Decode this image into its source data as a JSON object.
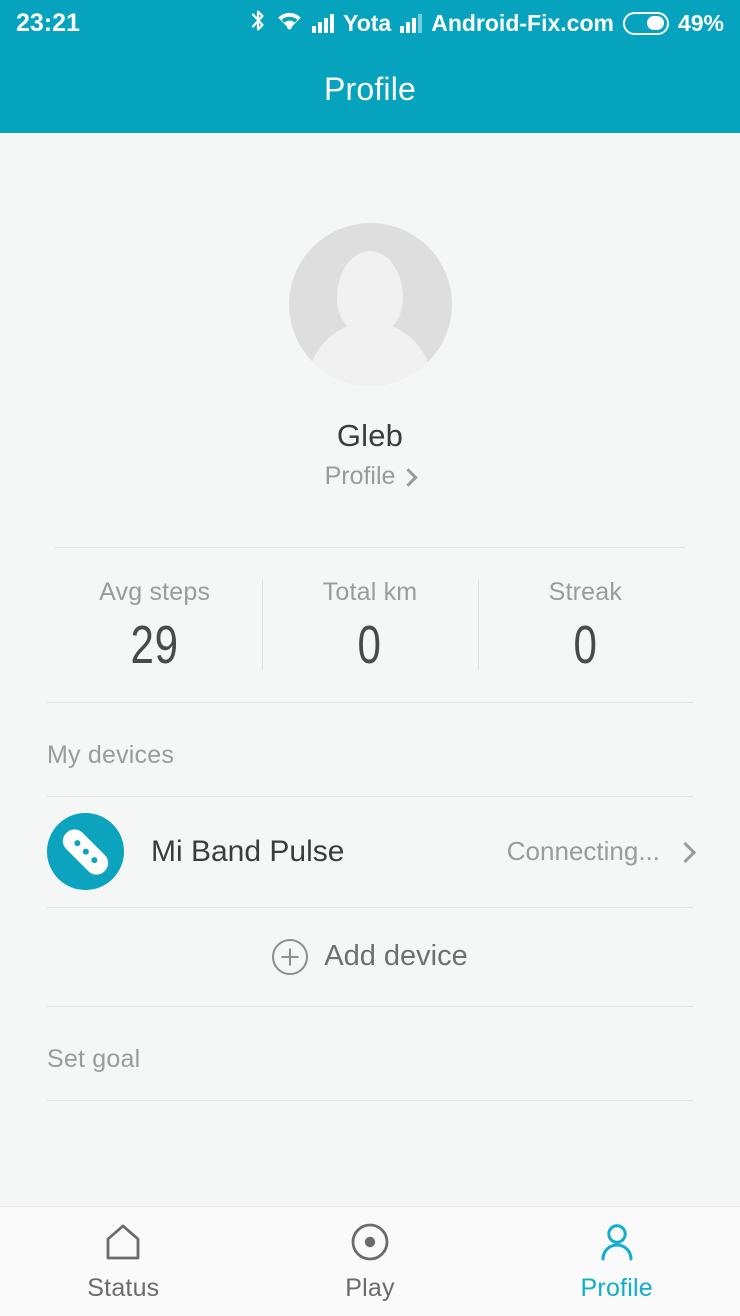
{
  "theme": {
    "accent": "#06a3bf",
    "accent_light": "#10aece",
    "page_bg": "#f5f6f6",
    "text_primary": "#3c3c3c",
    "text_muted": "#9b9b9b",
    "divider": "#e2e2e2"
  },
  "statusbar": {
    "clock": "23:21",
    "bluetooth_icon": "bluetooth-icon",
    "wifi_icon": "wifi-icon",
    "signal_icon_1": "signal-bars-icon",
    "carrier_1": "Yota",
    "signal_icon_2": "signal-bars-icon",
    "carrier_2": "Android-Fix.com",
    "battery_icon": "battery-icon",
    "battery_percent": "49%"
  },
  "appbar": {
    "title": "Profile"
  },
  "profile": {
    "avatar_icon": "avatar-placeholder-icon",
    "name": "Gleb",
    "link_label": "Profile",
    "link_chevron_icon": "chevron-right-icon"
  },
  "stats": [
    {
      "label": "Avg steps",
      "value": "29"
    },
    {
      "label": "Total km",
      "value": "0"
    },
    {
      "label": "Streak",
      "value": "0"
    }
  ],
  "devices_section": {
    "heading": "My devices",
    "device": {
      "icon": "mi-band-icon",
      "name": "Mi Band Pulse",
      "status": "Connecting...",
      "chevron_icon": "chevron-right-icon"
    },
    "add": {
      "icon": "plus-circle-icon",
      "label": "Add device"
    }
  },
  "goal_section": {
    "heading": "Set goal"
  },
  "bottomnav": {
    "items": [
      {
        "label": "Status",
        "icon": "home-icon",
        "active": false
      },
      {
        "label": "Play",
        "icon": "play-target-icon",
        "active": false
      },
      {
        "label": "Profile",
        "icon": "person-icon",
        "active": true
      }
    ]
  }
}
